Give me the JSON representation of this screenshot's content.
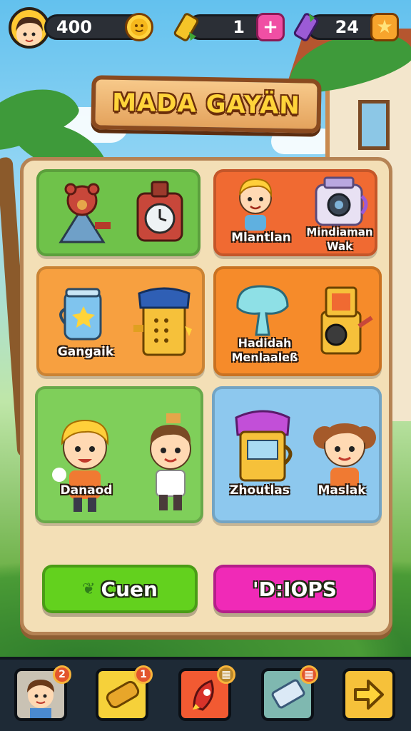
{
  "resources": {
    "coins": "400",
    "tickets": "1",
    "gems": "24",
    "tickets_button": "+",
    "gems_button": "★"
  },
  "title": "MADA GAYÄN",
  "cards": [
    {
      "label": "",
      "color": "#6fc24a"
    },
    {
      "label": "Mlantlan",
      "label2": "Mindiaman Wak",
      "color": "#f06a32"
    },
    {
      "label": "Gangaik",
      "label2": "",
      "color": "#f7a040"
    },
    {
      "label": "Hadidah Menlaaleß",
      "label2": "",
      "color": "#f68b2a"
    },
    {
      "label": "Danaod",
      "label2": "",
      "color": "#7fcf5a"
    },
    {
      "label": "Zhoutlas",
      "label2": "Maslak",
      "color": "#8dc8ee"
    }
  ],
  "actions": {
    "left": {
      "label": "Cuen",
      "icon": "leaf-icon",
      "color": "#63d11e"
    },
    "right": {
      "label": "'D:IOPS",
      "color": "#f02ab7"
    }
  },
  "bottom_nav": [
    {
      "icon": "character-icon",
      "badge": "2"
    },
    {
      "icon": "scroll-icon",
      "badge": "1"
    },
    {
      "icon": "rocket-icon",
      "badge": ""
    },
    {
      "icon": "ticket-icon",
      "badge": ""
    },
    {
      "icon": "arrow-right-icon",
      "badge": ""
    }
  ]
}
